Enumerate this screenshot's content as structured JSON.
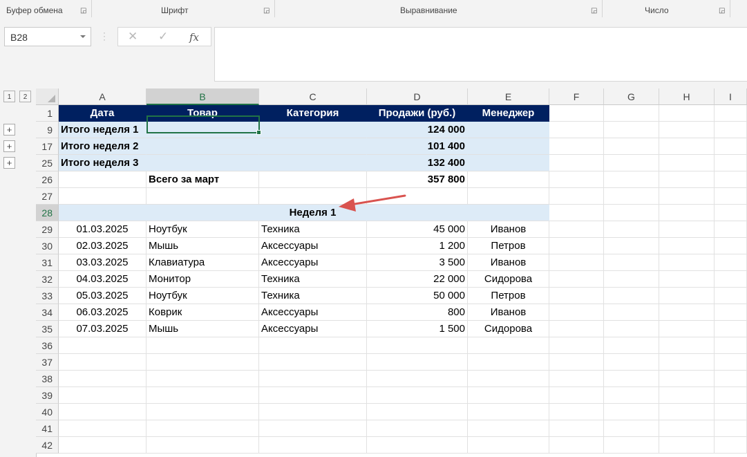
{
  "ribbon": {
    "groups": [
      "Буфер обмена",
      "Шрифт",
      "Выравнивание",
      "Число"
    ],
    "launcher_glyph": "◲"
  },
  "formula_bar": {
    "name_box": "B28",
    "cancel": "✕",
    "enter": "✓",
    "fx": "fx",
    "content": ""
  },
  "outline": {
    "levels": [
      "1",
      "2"
    ],
    "expand": [
      "+",
      "+",
      "+"
    ]
  },
  "columns": [
    "A",
    "B",
    "C",
    "D",
    "E",
    "F",
    "G",
    "H",
    "I"
  ],
  "selected_column": "B",
  "selected_row": "28",
  "rows": [
    {
      "num": "1",
      "cells": [
        "Дата",
        "Товар",
        "Категория",
        "Продажи (руб.)",
        "Менеджер"
      ]
    },
    {
      "num": "9",
      "cells": [
        "Итого неделя 1",
        "",
        "",
        "124 000",
        ""
      ]
    },
    {
      "num": "17",
      "cells": [
        "Итого неделя 2",
        "",
        "",
        "101 400",
        ""
      ]
    },
    {
      "num": "25",
      "cells": [
        "Итого неделя 3",
        "",
        "",
        "132 400",
        ""
      ]
    },
    {
      "num": "26",
      "cells": [
        "",
        "Всего за март",
        "",
        "357 800",
        ""
      ]
    },
    {
      "num": "27",
      "cells": [
        "",
        "",
        "",
        "",
        ""
      ]
    },
    {
      "num": "28",
      "cells": [
        "",
        "",
        "Неделя 1",
        "",
        ""
      ]
    },
    {
      "num": "29",
      "cells": [
        "01.03.2025",
        "Ноутбук",
        "Техника",
        "45 000",
        "Иванов"
      ]
    },
    {
      "num": "30",
      "cells": [
        "02.03.2025",
        "Мышь",
        "Аксессуары",
        "1 200",
        "Петров"
      ]
    },
    {
      "num": "31",
      "cells": [
        "03.03.2025",
        "Клавиатура",
        "Аксессуары",
        "3 500",
        "Иванов"
      ]
    },
    {
      "num": "32",
      "cells": [
        "04.03.2025",
        "Монитор",
        "Техника",
        "22 000",
        "Сидорова"
      ]
    },
    {
      "num": "33",
      "cells": [
        "05.03.2025",
        "Ноутбук",
        "Техника",
        "50 000",
        "Петров"
      ]
    },
    {
      "num": "34",
      "cells": [
        "06.03.2025",
        "Коврик",
        "Аксессуары",
        "800",
        "Иванов"
      ]
    },
    {
      "num": "35",
      "cells": [
        "07.03.2025",
        "Мышь",
        "Аксессуары",
        "1 500",
        "Сидорова"
      ]
    },
    {
      "num": "36",
      "cells": [
        "",
        "",
        "",
        "",
        ""
      ]
    },
    {
      "num": "37",
      "cells": [
        "",
        "",
        "",
        "",
        ""
      ]
    },
    {
      "num": "38",
      "cells": [
        "",
        "",
        "",
        "",
        ""
      ]
    },
    {
      "num": "39",
      "cells": [
        "",
        "",
        "",
        "",
        ""
      ]
    },
    {
      "num": "40",
      "cells": [
        "",
        "",
        "",
        "",
        ""
      ]
    },
    {
      "num": "41",
      "cells": [
        "",
        "",
        "",
        "",
        ""
      ]
    },
    {
      "num": "42",
      "cells": [
        "",
        "",
        "",
        "",
        ""
      ]
    }
  ],
  "colors": {
    "header_fill": "#002060",
    "group_fill": "#ddebf7",
    "selection": "#217346",
    "annotation_arrow": "#d9534f"
  }
}
